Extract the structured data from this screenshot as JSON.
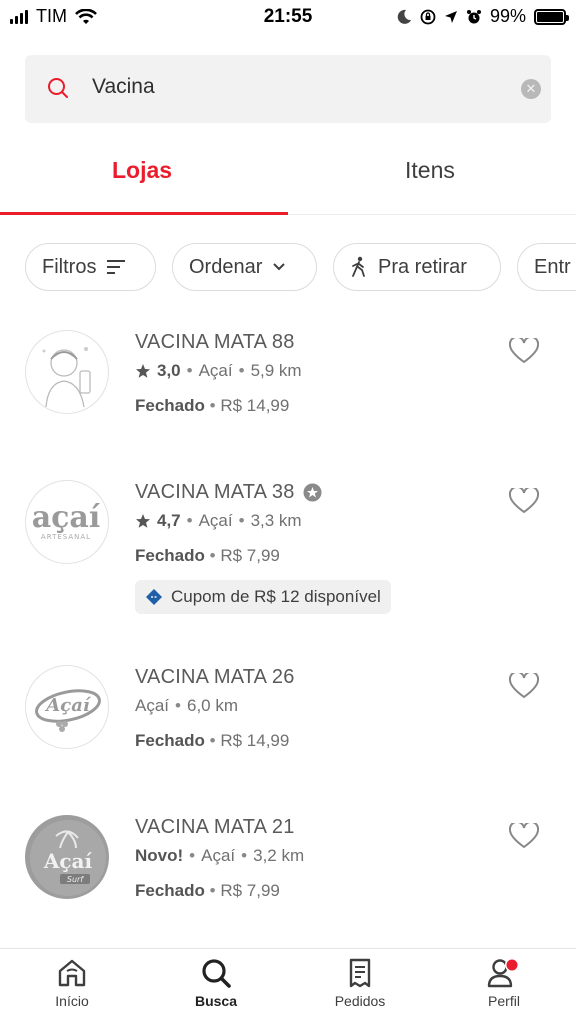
{
  "status_bar": {
    "carrier": "TIM",
    "time": "21:55",
    "battery": "99%"
  },
  "search": {
    "query": "Vacina"
  },
  "tabs": [
    {
      "label": "Lojas",
      "active": true
    },
    {
      "label": "Itens",
      "active": false
    }
  ],
  "chips": [
    {
      "label": "Filtros"
    },
    {
      "label": "Ordenar"
    },
    {
      "label": "Pra retirar"
    },
    {
      "label": "Entr"
    }
  ],
  "stores": [
    {
      "name": "VACINA MATA 88",
      "rating": "3,0",
      "category": "Açaí",
      "distance": "5,9 km",
      "status": "Fechado",
      "fee": "R$ 14,99",
      "logo_text": "",
      "favorite": false
    },
    {
      "name": "VACINA MATA 38",
      "badge": "super-badge-icon",
      "rating": "4,7",
      "category": "Açaí",
      "distance": "3,3 km",
      "status": "Fechado",
      "fee": "R$ 7,99",
      "coupon": "Cupom de R$ 12 disponível",
      "logo_text": "açaí",
      "logo_subtext": "ARTESANAL",
      "favorite": false
    },
    {
      "name": "VACINA MATA 26",
      "category": "Açaí",
      "distance": "6,0 km",
      "status": "Fechado",
      "fee": "R$ 14,99",
      "logo_text": "Açaí",
      "favorite": false
    },
    {
      "name": "VACINA MATA 21",
      "new_label": "Novo!",
      "category": "Açaí",
      "distance": "3,2 km",
      "status": "Fechado",
      "fee": "R$ 7,99",
      "logo_text": "Açaí",
      "logo_subtext": "Surf",
      "favorite": false
    }
  ],
  "nav": [
    {
      "label": "Início",
      "icon": "home-icon",
      "active": false
    },
    {
      "label": "Busca",
      "icon": "search-icon",
      "active": true
    },
    {
      "label": "Pedidos",
      "icon": "orders-icon",
      "active": false
    },
    {
      "label": "Perfil",
      "icon": "profile-icon",
      "active": false,
      "notification": true
    }
  ],
  "colors": {
    "accent": "#ea1d2c",
    "coupon_icon": "#1f5fa8"
  }
}
